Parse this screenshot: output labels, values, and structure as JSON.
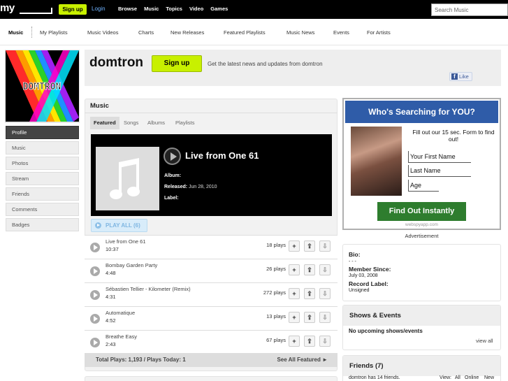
{
  "topbar": {
    "logo": "my",
    "signup": "Sign up",
    "login": "Login",
    "nav": [
      "Browse",
      "Music",
      "Topics",
      "Video",
      "Games"
    ],
    "search_placeholder": "Search Music"
  },
  "subnav": {
    "items": [
      {
        "label": "Music",
        "active": true
      },
      {
        "label": "My Playlists"
      },
      {
        "label": "Music Videos"
      },
      {
        "label": "Charts"
      },
      {
        "label": "New Releases"
      },
      {
        "label": "Featured Playlists"
      },
      {
        "label": "Music News"
      },
      {
        "label": "Events"
      },
      {
        "label": "For Artists"
      }
    ]
  },
  "sidebar": {
    "items": [
      {
        "label": "Profile",
        "active": true
      },
      {
        "label": "Music"
      },
      {
        "label": "Photos"
      },
      {
        "label": "Stream"
      },
      {
        "label": "Friends"
      },
      {
        "label": "Comments"
      },
      {
        "label": "Badges"
      }
    ],
    "profile_image_text": "DOMTRON"
  },
  "header": {
    "artist": "domtron",
    "signup": "Sign up",
    "tagline": "Get the latest news and updates from domtron",
    "like": "Like"
  },
  "music": {
    "title": "Music",
    "tabs": [
      "Featured",
      "Songs",
      "Albums",
      "Playlists"
    ],
    "featured": {
      "label": "",
      "title": "Live from One 61",
      "album_label": "Album:",
      "album": "",
      "released_label": "Released:",
      "released": "Jun 28, 2010",
      "label_label": "Label:"
    },
    "play_all": "PLAY ALL (6)",
    "tracks": [
      {
        "title": "Live from One 61",
        "duration": "10:37",
        "plays": "18 plays"
      },
      {
        "title": "Bombay Garden Party",
        "duration": "4:48",
        "plays": "26 plays"
      },
      {
        "title": "Sébastien Tellier - Kilometer (Remix)",
        "duration": "4:31",
        "plays": "272 plays"
      },
      {
        "title": "Automatique",
        "duration": "4:52",
        "plays": "13 plays"
      },
      {
        "title": "Breathe Easy",
        "duration": "2:43",
        "plays": "67 plays"
      }
    ],
    "totals": "Total Plays: 1,193 / Plays Today: 1",
    "see_all": "See All Featured ►"
  },
  "ad": {
    "headline": "Who's Searching for YOU?",
    "body": "Fill out our 15 sec. Form to find out!",
    "field1": "Your First Name",
    "field2": "Last Name",
    "field3": "Age",
    "cta": "Find Out Instantly",
    "url": "webspyapp.com",
    "caption": "Advertisement"
  },
  "info": {
    "bio_label": "Bio:",
    "bio_value": "- - -",
    "member_since_label": "Member Since:",
    "member_since": "July 03, 2008",
    "record_label_label": "Record Label:",
    "record_label": "Unsigned"
  },
  "shows": {
    "title": "Shows & Events",
    "empty": "No upcoming shows/events",
    "view_all": "view all"
  },
  "friends": {
    "title": "Friends (7)",
    "count_text": "domtron has 14 friends.",
    "view_label": "View:",
    "view_all": "All",
    "view_online": "Online",
    "view_new": "New"
  },
  "colors": {
    "accent_green": "#c8f000",
    "ad_blue": "#2f5ca8",
    "cta_green": "#2e7d2e",
    "featured_orange": "#ff9900"
  }
}
